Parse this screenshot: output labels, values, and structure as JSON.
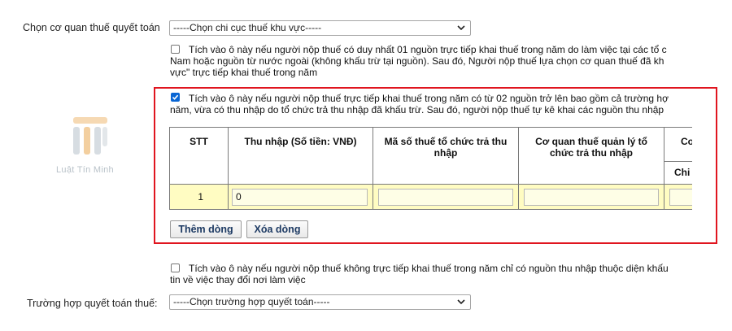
{
  "form": {
    "tax_office_label": "Chọn cơ quan thuế quyết toán",
    "tax_office_select": "-----Chọn chi cục thuế khu vực-----",
    "option1": {
      "checked": false,
      "line1": "Tích vào ô này nếu người nộp thuế có duy nhất 01 nguồn trực tiếp khai thuế trong năm do làm việc tại các tổ c",
      "line2": "Nam hoặc nguồn từ nước ngoài (không khấu trừ tại nguồn). Sau đó, Người nộp thuế lựa chọn cơ quan thuế đã kh",
      "line3": "vực\" trực tiếp khai thuế trong năm"
    },
    "option2": {
      "checked": true,
      "line1": "Tích vào ô này nếu người nộp thuế trực tiếp khai thuế trong năm có từ 02 nguồn trở lên bao gồm cả trường hợ",
      "line2": "năm, vừa có thu nhập do tổ chức trả thu nhập đã khấu trừ. Sau đó, người nộp thuế tự kê khai các nguồn thu nhập"
    },
    "income_table": {
      "headers": {
        "stt": "STT",
        "income": "Thu nhập (Số tiền: VNĐ)",
        "tax_id": "Mã số thuế tổ chức trả thu nhập",
        "tax_office": "Cơ quan thuế quản lý tổ chức trả thu nhập",
        "next": "Co",
        "next_sub": "Chi"
      },
      "rows": [
        {
          "stt": "1",
          "income": "0",
          "tax_id": "",
          "tax_office": "",
          "next": ""
        }
      ]
    },
    "add_row_button": "Thêm dòng",
    "delete_row_button": "Xóa dòng",
    "option3": {
      "checked": false,
      "line1": "Tích vào ô này nếu người nộp thuế không trực tiếp khai thuế trong năm chỉ có nguồn thu nhập thuộc diện khấu",
      "line2": "tin về việc thay đổi nơi làm việc"
    },
    "settlement_case_label": "Trường hợp quyết toán thuế:",
    "settlement_case_select": "-----Chọn trường hợp quyết toán-----"
  },
  "watermark": {
    "text": "Luật Tín Minh"
  },
  "colors": {
    "highlight_border": "#e0151f",
    "row_background": "#fffcc2",
    "checkbox_checked": "#0a66d4",
    "button_text": "#1d3a63"
  }
}
